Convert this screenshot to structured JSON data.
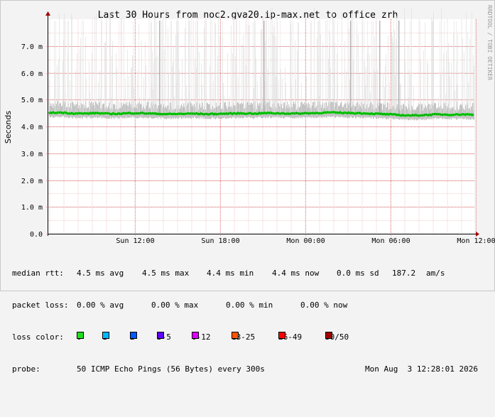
{
  "chart_data": {
    "type": "area",
    "title": "Last 30 Hours from noc2.gva20.ip-max.net to office_zrh",
    "ylabel": "Seconds",
    "side_text": "RRDTOOL / TOBI OETIKER",
    "yticks": [
      "0.0",
      "1.0 m",
      "2.0 m",
      "3.0 m",
      "4.0 m",
      "5.0 m",
      "6.0 m",
      "7.0 m"
    ],
    "ylim": [
      0,
      0.008
    ],
    "xticks": [
      "Sun 12:00",
      "Sun 18:00",
      "Mon 00:00",
      "Mon 06:00",
      "Mon 12:00"
    ],
    "grid": true,
    "series": [
      {
        "name": "median rtt",
        "color": "#00cc00",
        "values_ms": [
          4.5,
          4.52,
          4.49,
          4.48,
          4.5,
          4.47,
          4.48,
          4.5,
          4.49,
          4.47,
          4.46,
          4.47,
          4.48,
          4.46,
          4.47,
          4.48,
          4.49,
          4.48,
          4.5,
          4.49,
          4.48,
          4.49,
          4.5,
          4.52,
          4.51,
          4.5,
          4.49,
          4.47,
          4.45,
          4.42,
          4.41,
          4.43,
          4.45,
          4.44,
          4.45,
          4.44
        ]
      }
    ]
  },
  "stats": {
    "median_label": "median rtt:",
    "median_avg": "4.5 ms avg",
    "median_max": "4.5 ms max",
    "median_min": "4.4 ms min",
    "median_now": "4.4 ms now",
    "median_sd": "0.0 ms sd",
    "median_ams": "187.2",
    "median_unit": "am/s",
    "loss_label": "packet loss:",
    "loss_avg": "0.00 % avg",
    "loss_max": "0.00 % max",
    "loss_min": "0.00 % min",
    "loss_now": "0.00 % now",
    "color_label": "loss color:",
    "loss_colors": [
      {
        "label": "0",
        "color": "#20dd20"
      },
      {
        "label": "1",
        "color": "#00b8ff"
      },
      {
        "label": "2",
        "color": "#0059ff"
      },
      {
        "label": "3-5",
        "color": "#5e00ff"
      },
      {
        "label": "6-12",
        "color": "#dd00ff"
      },
      {
        "label": "13-25",
        "color": "#ff5500"
      },
      {
        "label": "26-49",
        "color": "#ff0000"
      },
      {
        "label": "50/50",
        "color": "#a00000"
      }
    ],
    "probe_label": "probe:",
    "probe_text": "50 ICMP Echo Pings (56 Bytes) every 300s",
    "date": "Mon Aug  3 12:28:01 2026"
  }
}
